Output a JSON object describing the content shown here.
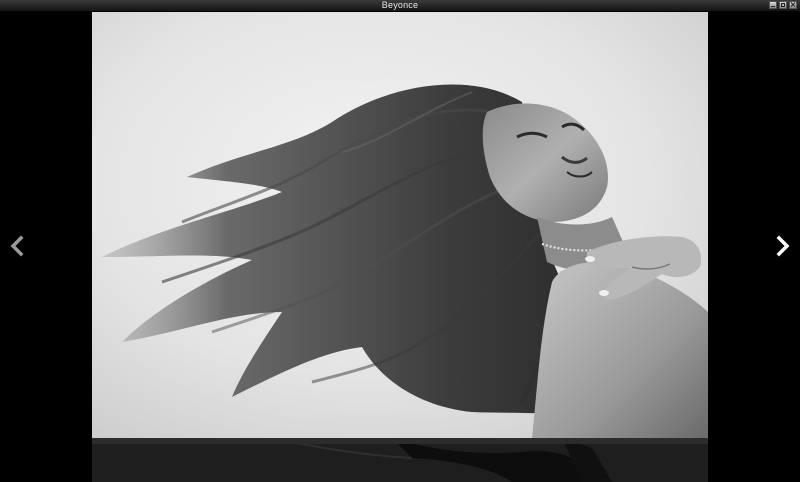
{
  "window": {
    "title": "Beyonce",
    "controls": [
      "minimize-icon",
      "maximize-icon",
      "close-icon"
    ]
  },
  "viewer": {
    "image_name": "photo",
    "navigation": {
      "previous": "chevron-left-icon",
      "next": "chevron-right-icon"
    },
    "colors": {
      "background": "#000000",
      "prev_arrow": "#9a9a9a",
      "next_arrow": "#ffffff"
    }
  }
}
